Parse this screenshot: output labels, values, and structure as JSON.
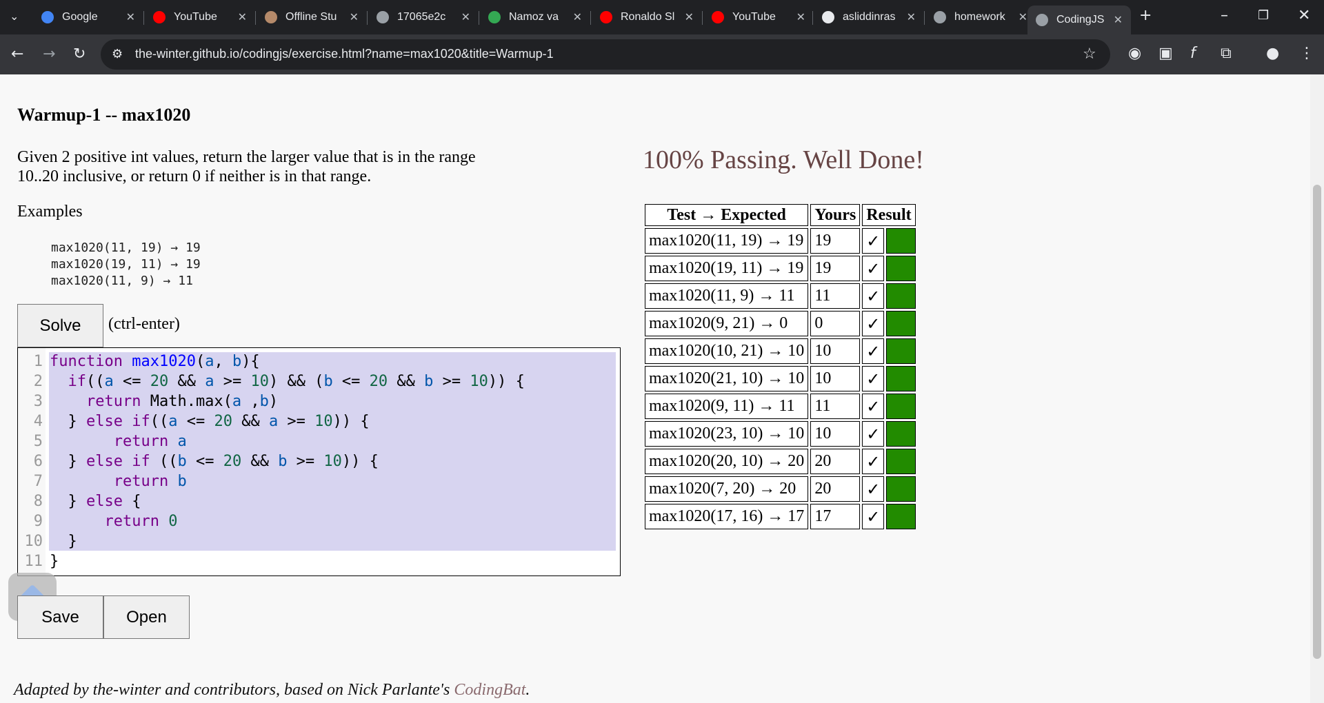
{
  "browser": {
    "tabs": [
      {
        "label": "Google",
        "icon": "google-icon",
        "color": "#4285f4"
      },
      {
        "label": "YouTube",
        "icon": "youtube-icon",
        "color": "#ff0000"
      },
      {
        "label": "Offline Stu",
        "icon": "offline-icon",
        "color": "#b58a6a"
      },
      {
        "label": "17065e2c",
        "icon": "globe-icon",
        "color": "#9aa0a6"
      },
      {
        "label": "Namoz va",
        "icon": "chart-icon",
        "color": "#34a853"
      },
      {
        "label": "Ronaldo Sl",
        "icon": "youtube-icon",
        "color": "#ff0000"
      },
      {
        "label": "YouTube",
        "icon": "youtube-icon",
        "color": "#ff0000"
      },
      {
        "label": "asliddinras",
        "icon": "github-icon",
        "color": "#e8eaed"
      },
      {
        "label": "homework",
        "icon": "globe-icon",
        "color": "#9aa0a6"
      },
      {
        "label": "CodingJS",
        "icon": "globe-icon",
        "color": "#9aa0a6"
      }
    ],
    "url": "the-winter.github.io/codingjs/exercise.html?name=max1020&title=Warmup-1"
  },
  "exercise": {
    "title": "Warmup-1 -- max1020",
    "description": "Given 2 positive int values, return the larger value that is in the range 10..20 inclusive, or return 0 if neither is in that range.",
    "examples_label": "Examples",
    "examples": [
      "max1020(11, 19) → 19",
      "max1020(19, 11) → 19",
      "max1020(11, 9) → 11"
    ],
    "solve_label": "Solve",
    "shortcut_hint": "(ctrl-enter)",
    "save_label": "Save",
    "open_label": "Open"
  },
  "editor": {
    "line_numbers": [
      "1",
      "2",
      "3",
      "4",
      "5",
      "6",
      "7",
      "8",
      "9",
      "10",
      "11"
    ]
  },
  "results": {
    "status": "100% Passing. Well Done!",
    "headers": [
      "Test → Expected",
      "Yours",
      "Result"
    ],
    "pass_color": "#228b00",
    "rows": [
      {
        "test": "max1020(11, 19) → 19",
        "yours": "19",
        "mark": "✓"
      },
      {
        "test": "max1020(19, 11) → 19",
        "yours": "19",
        "mark": "✓"
      },
      {
        "test": "max1020(11, 9) → 11",
        "yours": "11",
        "mark": "✓"
      },
      {
        "test": "max1020(9, 21) → 0",
        "yours": "0",
        "mark": "✓"
      },
      {
        "test": "max1020(10, 21) → 10",
        "yours": "10",
        "mark": "✓"
      },
      {
        "test": "max1020(21, 10) → 10",
        "yours": "10",
        "mark": "✓"
      },
      {
        "test": "max1020(9, 11) → 11",
        "yours": "11",
        "mark": "✓"
      },
      {
        "test": "max1020(23, 10) → 10",
        "yours": "10",
        "mark": "✓"
      },
      {
        "test": "max1020(20, 10) → 20",
        "yours": "20",
        "mark": "✓"
      },
      {
        "test": "max1020(7, 20) → 20",
        "yours": "20",
        "mark": "✓"
      },
      {
        "test": "max1020(17, 16) → 17",
        "yours": "17",
        "mark": "✓"
      }
    ]
  },
  "footer": {
    "text": "Adapted by the-winter and contributors, based on Nick Parlante's ",
    "link": "CodingBat",
    "end": "."
  }
}
